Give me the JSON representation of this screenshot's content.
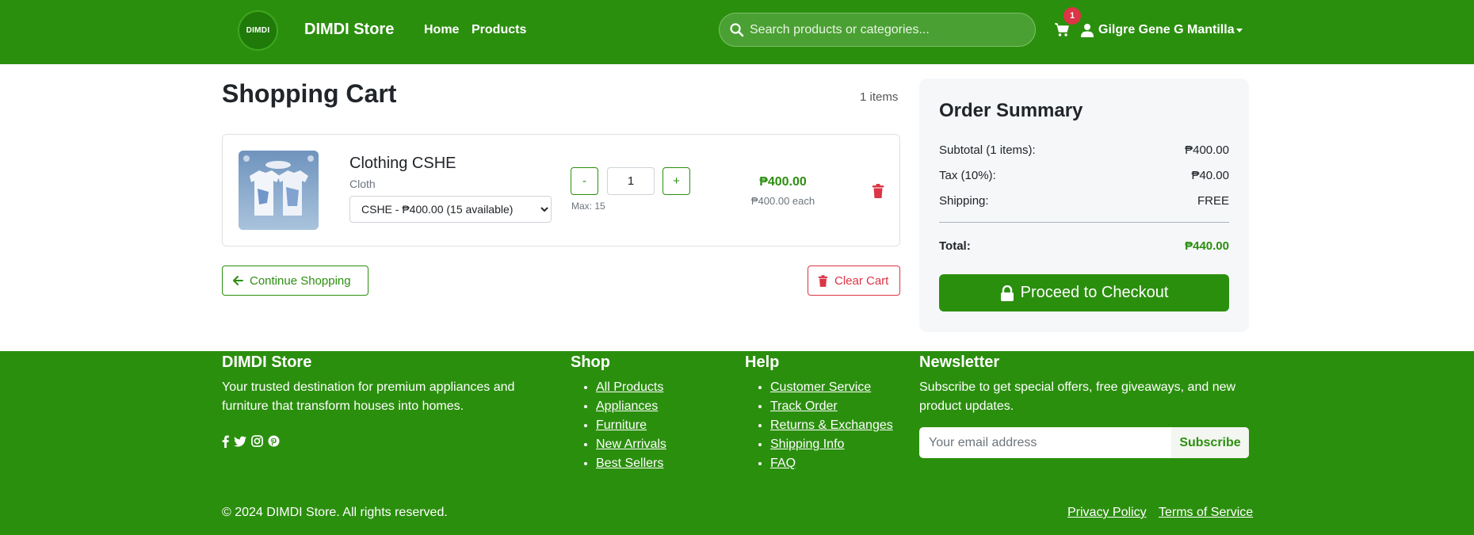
{
  "navbar": {
    "logo_text": "DIMDI",
    "brand": "DIMDI Store",
    "links": [
      "Home",
      "Products"
    ],
    "search_placeholder": "Search products or categories...",
    "cart_count": "1",
    "user_name": "Gilgre Gene G Mantilla"
  },
  "cart": {
    "title": "Shopping Cart",
    "items_count": "1 items",
    "items": [
      {
        "name": "Clothing CSHE",
        "category": "Cloth",
        "variant": "CSHE - ₱400.00 (15 available)",
        "qty_minus": "-",
        "qty_plus": "+",
        "quantity": "1",
        "max": "Max: 15",
        "line_price": "₱400.00",
        "each_price": "₱400.00 each"
      }
    ],
    "continue_label": "Continue Shopping",
    "clear_label": "Clear Cart"
  },
  "summary": {
    "title": "Order Summary",
    "subtotal_label": "Subtotal (1 items):",
    "subtotal_value": "₱400.00",
    "tax_label": "Tax (10%):",
    "tax_value": "₱40.00",
    "shipping_label": "Shipping:",
    "shipping_value": "FREE",
    "total_label": "Total:",
    "total_value": "₱440.00",
    "checkout_label": "Proceed to Checkout"
  },
  "footer": {
    "about_title": "DIMDI Store",
    "about_text": "Your trusted destination for premium appliances and furniture that transform houses into homes.",
    "social_icons": [
      "facebook-icon",
      "twitter-icon",
      "instagram-icon",
      "pinterest-icon"
    ],
    "shop_title": "Shop",
    "shop_links": [
      "All Products",
      "Appliances",
      "Furniture",
      "New Arrivals",
      "Best Sellers"
    ],
    "help_title": "Help",
    "help_links": [
      "Customer Service",
      "Track Order",
      "Returns & Exchanges",
      "Shipping Info",
      "FAQ"
    ],
    "newsletter_title": "Newsletter",
    "newsletter_text": "Subscribe to get special offers, free giveaways, and new product updates.",
    "email_placeholder": "Your email address",
    "subscribe_label": "Subscribe",
    "copyright": "© 2024 DIMDI Store. All rights reserved.",
    "privacy": "Privacy Policy",
    "terms": "Terms of Service"
  },
  "colors": {
    "brand_green": "#2b8f0e",
    "danger_red": "#dc3545"
  }
}
